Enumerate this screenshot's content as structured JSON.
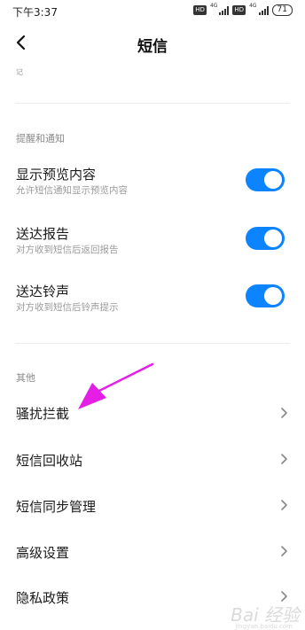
{
  "status": {
    "time": "下午3:37",
    "hd1": "HD",
    "net1": "4G",
    "hd2": "HD",
    "net2": "4G",
    "battery": "71"
  },
  "nav": {
    "title": "短信"
  },
  "cut_label": "记",
  "notifications": {
    "header": "提醒和通知",
    "items": [
      {
        "title": "显示预览内容",
        "subtitle": "允许短信通知显示预览内容",
        "enabled": true
      },
      {
        "title": "送达报告",
        "subtitle": "对方收到短信后返回报告",
        "enabled": true
      },
      {
        "title": "送达铃声",
        "subtitle": "对方收到短信后铃声提示",
        "enabled": true
      }
    ]
  },
  "other": {
    "header": "其他",
    "items": [
      {
        "title": "骚扰拦截"
      },
      {
        "title": "短信回收站"
      },
      {
        "title": "短信同步管理"
      },
      {
        "title": "高级设置"
      },
      {
        "title": "隐私政策"
      }
    ]
  },
  "colors": {
    "toggle_on": "#0d84ff",
    "annotation_arrow": "#e51ee5"
  },
  "watermark": {
    "text": "Bai 经验",
    "sub": "jingyan.baidu.com"
  }
}
